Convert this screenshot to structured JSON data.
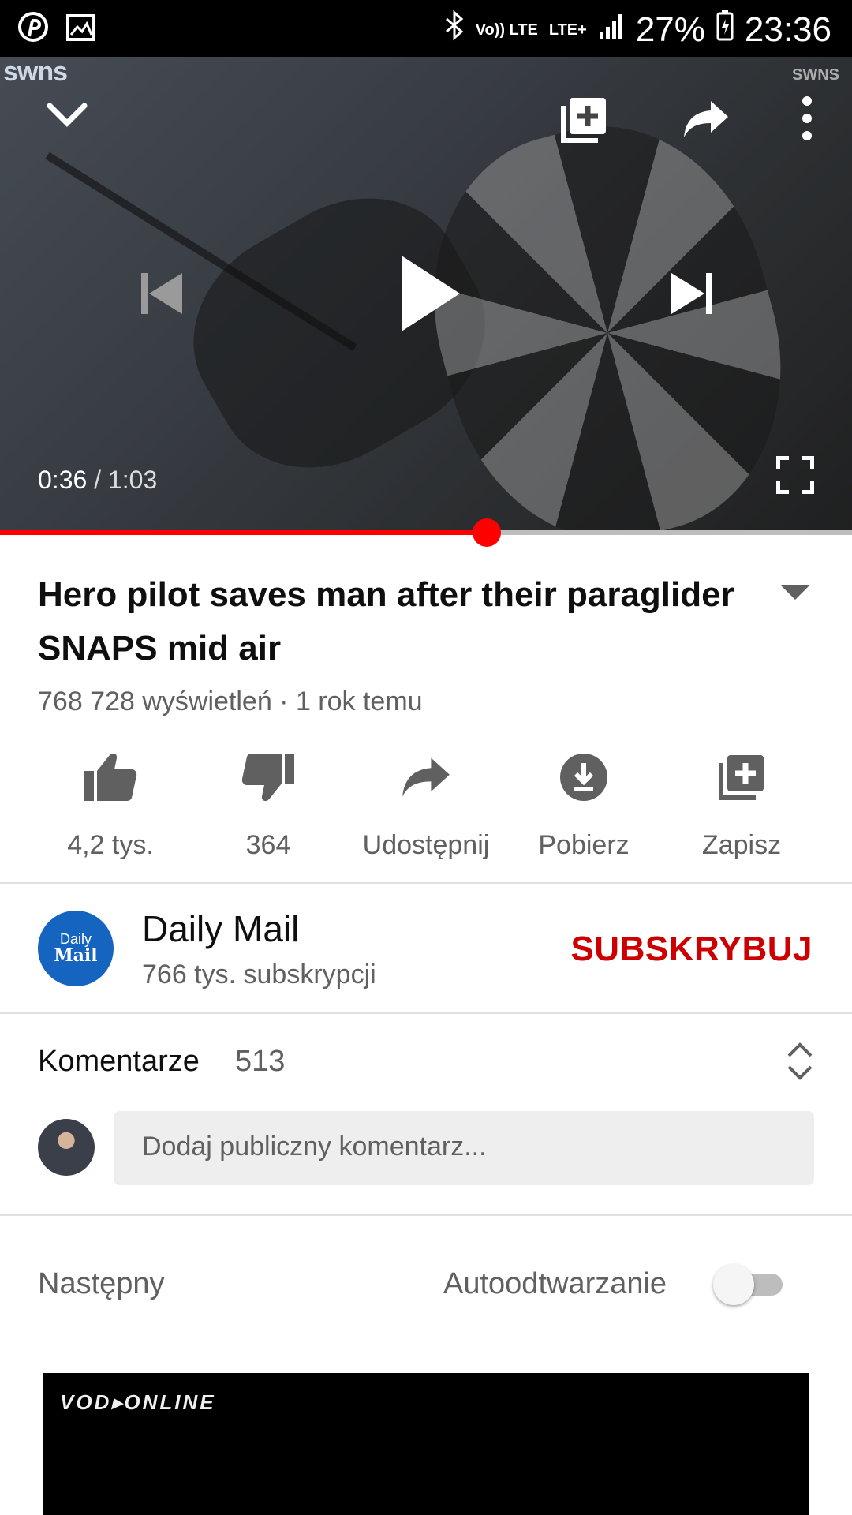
{
  "status_bar": {
    "network": "LTE+",
    "volte": "Vo)) LTE",
    "battery": "27%",
    "time": "23:36"
  },
  "video": {
    "watermark_left": "swns",
    "watermark_right": "SWNS",
    "current_time": "0:36",
    "separator": " / ",
    "duration": "1:03",
    "progress": 0.571
  },
  "info": {
    "title": "Hero pilot saves man after their paraglider SNAPS mid air",
    "meta": "768 728 wyświetleń · 1 rok temu"
  },
  "actions": [
    {
      "icon": "thumb-up-icon",
      "label": "4,2 tys."
    },
    {
      "icon": "thumb-down-icon",
      "label": "364"
    },
    {
      "icon": "share-icon",
      "label": "Udostępnij"
    },
    {
      "icon": "download-icon",
      "label": "Pobierz"
    },
    {
      "icon": "add-to-playlist-icon",
      "label": "Zapisz"
    }
  ],
  "channel": {
    "avatar_line1": "Daily",
    "avatar_line2": "Mail",
    "name": "Daily Mail",
    "subscribers": "766 tys. subskrypcji",
    "subscribe_label": "SUBSKRYBUJ"
  },
  "comments": {
    "label": "Komentarze",
    "count": "513",
    "placeholder": "Dodaj publiczny komentarz..."
  },
  "up_next": {
    "label": "Następny",
    "autoplay_label": "Autoodtwarzanie",
    "autoplay_on": false,
    "next_thumb_brand": "VOD▸ONLINE"
  },
  "colors": {
    "accent_red": "#ff0000",
    "subscribe_red": "#cc0000",
    "avatar_blue": "#1565c0"
  }
}
